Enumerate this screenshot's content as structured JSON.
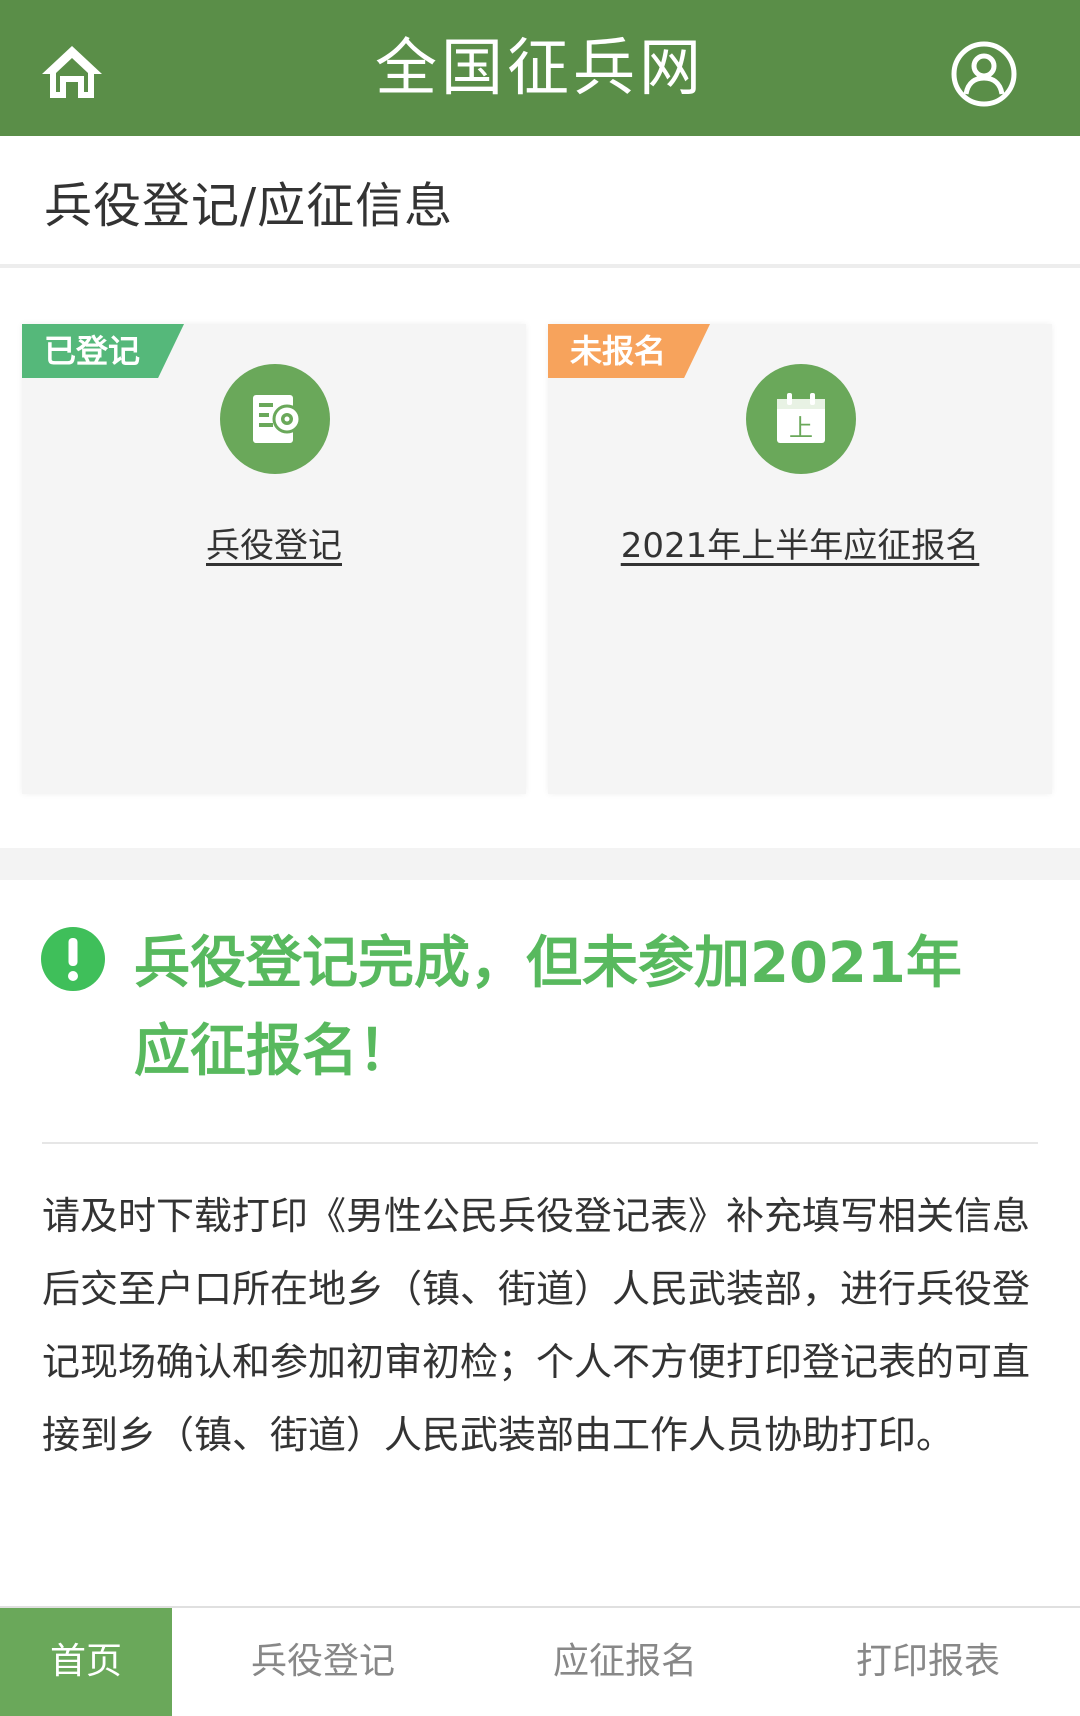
{
  "header": {
    "title": "全国征兵网",
    "home_icon": "home-icon",
    "user_icon": "user-circle-icon",
    "bg_color": "#5a8e48"
  },
  "section": {
    "heading": "兵役登记/应征信息"
  },
  "cards": [
    {
      "badge": "已登记",
      "badge_color": "#55b87a",
      "icon": "registration-form-icon",
      "label": "兵役登记"
    },
    {
      "badge": "未报名",
      "badge_color": "#f7a35c",
      "icon": "calendar-icon",
      "calendar_glyph": "上",
      "label": "2021年上半年应征报名"
    }
  ],
  "notice": {
    "icon": "exclamation-circle-icon",
    "title": "兵役登记完成，但未参加2021年应征报名！",
    "body": "请及时下载打印《男性公民兵役登记表》补充填写相关信息后交至户口所在地乡（镇、街道）人民武装部，进行兵役登记现场确认和参加初审初检；个人不方便打印登记表的可直接到乡（镇、街道）人民武装部由工作人员协助打印。",
    "title_color": "#58b95e"
  },
  "bottom_nav": {
    "items": [
      {
        "label": "首页",
        "active": true
      },
      {
        "label": "兵役登记",
        "active": false
      },
      {
        "label": "应征报名",
        "active": false
      },
      {
        "label": "打印报表",
        "active": false
      }
    ],
    "active_color": "#6aa85a"
  }
}
